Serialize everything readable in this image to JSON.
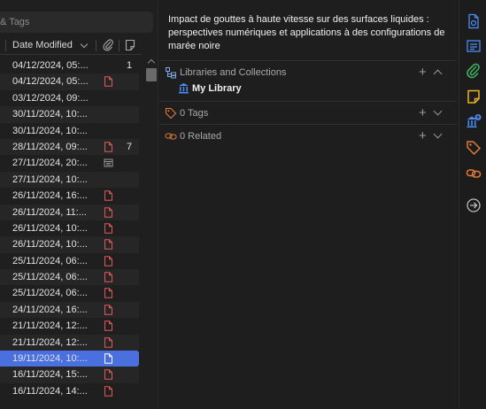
{
  "search": {
    "placeholder_partial": "& Tags"
  },
  "columns": {
    "date_modified": "Date Modified"
  },
  "rows": [
    {
      "date": "04/12/2024, 05:...",
      "attachment": "",
      "count": "1"
    },
    {
      "date": "04/12/2024, 05:...",
      "attachment": "pdf",
      "count": ""
    },
    {
      "date": "03/12/2024, 09:...",
      "attachment": "",
      "count": ""
    },
    {
      "date": "30/11/2024, 10:...",
      "attachment": "",
      "count": ""
    },
    {
      "date": "30/11/2024, 10:...",
      "attachment": "",
      "count": ""
    },
    {
      "date": "28/11/2024, 09:...",
      "attachment": "pdf",
      "count": "7"
    },
    {
      "date": "27/11/2024, 20:...",
      "attachment": "snapshot",
      "count": ""
    },
    {
      "date": "27/11/2024, 10:...",
      "attachment": "",
      "count": ""
    },
    {
      "date": "26/11/2024, 16:...",
      "attachment": "pdf",
      "count": ""
    },
    {
      "date": "26/11/2024, 11:...",
      "attachment": "pdf",
      "count": ""
    },
    {
      "date": "26/11/2024, 10:...",
      "attachment": "pdf",
      "count": ""
    },
    {
      "date": "26/11/2024, 10:...",
      "attachment": "pdf",
      "count": ""
    },
    {
      "date": "25/11/2024, 06:...",
      "attachment": "pdf",
      "count": ""
    },
    {
      "date": "25/11/2024, 06:...",
      "attachment": "pdf",
      "count": ""
    },
    {
      "date": "25/11/2024, 06:...",
      "attachment": "pdf",
      "count": ""
    },
    {
      "date": "24/11/2024, 16:...",
      "attachment": "pdf",
      "count": ""
    },
    {
      "date": "21/11/2024, 12:...",
      "attachment": "pdf",
      "count": ""
    },
    {
      "date": "21/11/2024, 12:...",
      "attachment": "pdf",
      "count": ""
    },
    {
      "date": "19/11/2024, 10:...",
      "attachment": "pdf",
      "count": "",
      "selected": true
    },
    {
      "date": "16/11/2024, 15:...",
      "attachment": "pdf",
      "count": ""
    },
    {
      "date": "16/11/2024, 14:...",
      "attachment": "pdf",
      "count": ""
    }
  ],
  "item": {
    "title": "Impact de gouttes à haute vitesse sur des surfaces liquides : perspectives numériques et applications à des configurations de marée noire"
  },
  "sections": {
    "libraries": {
      "label": "Libraries and Collections",
      "library_name": "My Library"
    },
    "tags": {
      "label": "0 Tags"
    },
    "related": {
      "label": "0 Related"
    }
  },
  "sidenav": [
    "info-icon",
    "abstract-icon",
    "attachments-icon",
    "notes-icon",
    "libraries-collections-icon",
    "tags-icon",
    "related-icon",
    "locate-icon"
  ],
  "colors": {
    "accent": "#4a6fdf",
    "pdf_red": "#e05a5a",
    "icon_blue": "#4c8cf5",
    "icon_green": "#3fae5c",
    "icon_yellow": "#e8b52a",
    "icon_orange": "#e07b39"
  }
}
